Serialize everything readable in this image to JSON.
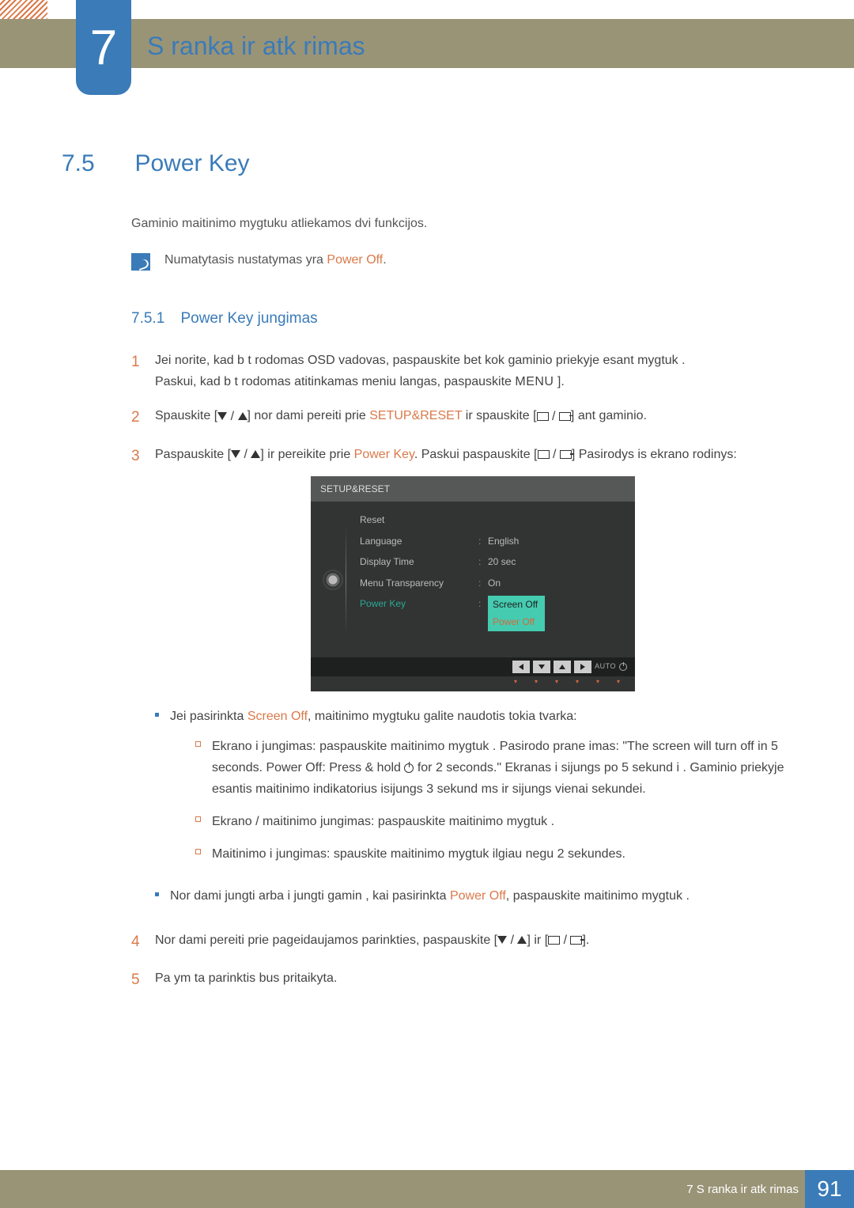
{
  "chapter": {
    "number": "7",
    "title": "S ranka ir atk rimas"
  },
  "section": {
    "number": "7.5",
    "title": "Power Key"
  },
  "intro": "Gaminio maitinimo mygtuku atliekamos dvi funkcijos.",
  "note": {
    "pre": "Numatytasis nustatymas yra ",
    "hl": "Power Off",
    "post": "."
  },
  "subsection": {
    "number": "7.5.1",
    "title": "Power Key  jungimas"
  },
  "steps": {
    "1": {
      "a": "Jei norite, kad b t  rodomas OSD vadovas, paspauskite bet kok  gaminio priekyje esant  mygtuk .",
      "b": "Paskui, kad b t  rodomas atitinkamas meniu langas, paspauskite ",
      "menu": "MENU",
      "c": " ]."
    },
    "2": {
      "a": "Spauskite [",
      "b": "] nor dami pereiti prie ",
      "hl": "SETUP&RESET",
      "c": " ir spauskite [",
      "d": "] ant gaminio."
    },
    "3": {
      "a": "Paspauskite [",
      "b": "] ir pereikite prie ",
      "hl": "Power Key",
      "c": ". Paskui paspauskite [",
      "d": "] Pasirodys  is ekrano rodinys:"
    },
    "4": {
      "a": "Nor dami pereiti prie pageidaujamos parinkties, paspauskite [",
      "b": "] ir [",
      "c": "]."
    },
    "5": "Pa ym ta parinktis bus pritaikyta."
  },
  "osd": {
    "title": "SETUP&RESET",
    "rows": {
      "reset": "Reset",
      "language_l": "Language",
      "language_v": "English",
      "display_l": "Display Time",
      "display_v": "20 sec",
      "trans_l": "Menu Transparency",
      "trans_v": "On",
      "power_l": "Power Key",
      "power_v1": "Screen Off",
      "power_v2": "Power Off"
    },
    "auto": "AUTO"
  },
  "bullets": {
    "b1": {
      "a": "Jei pasirinkta ",
      "hl": "Screen Off",
      "b": ", maitinimo mygtuku galite naudotis tokia tvarka:"
    },
    "s1": "Ekrano i jungimas: paspauskite maitinimo mygtuk . Pasirodo prane imas: \"The screen will turn off in 5 seconds. Power Off: Press & hold  for 2 seconds.\" Ekranas i sijungs po 5 sekund i . Gaminio priekyje esantis maitinimo indikatorius isijungs 3 sekund ms ir  sijungs vienai sekundei.",
    "s1a": "Ekrano i jungimas: paspauskite maitinimo mygtuk . Pasirodo prane imas: \"The screen will turn off in 5 seconds. Power Off: Press & hold ",
    "s1b": " for 2 seconds.\" Ekranas i sijungs po 5 sekund i . Gaminio priekyje esantis maitinimo indikatorius isijungs 3 sekund ms ir  sijungs vienai sekundei.",
    "s2": "Ekrano / maitinimo  jungimas: paspauskite maitinimo mygtuk .",
    "s3": "Maitinimo i jungimas: spauskite maitinimo mygtuk  ilgiau negu 2 sekundes.",
    "b2": {
      "a": "Nor dami  jungti arba i jungti gamin , kai pasirinkta ",
      "hl": "Power Off",
      "b": ", paspauskite maitinimo mygtuk ."
    }
  },
  "footer": {
    "text": "7 S ranka ir atk rimas",
    "page": "91"
  }
}
